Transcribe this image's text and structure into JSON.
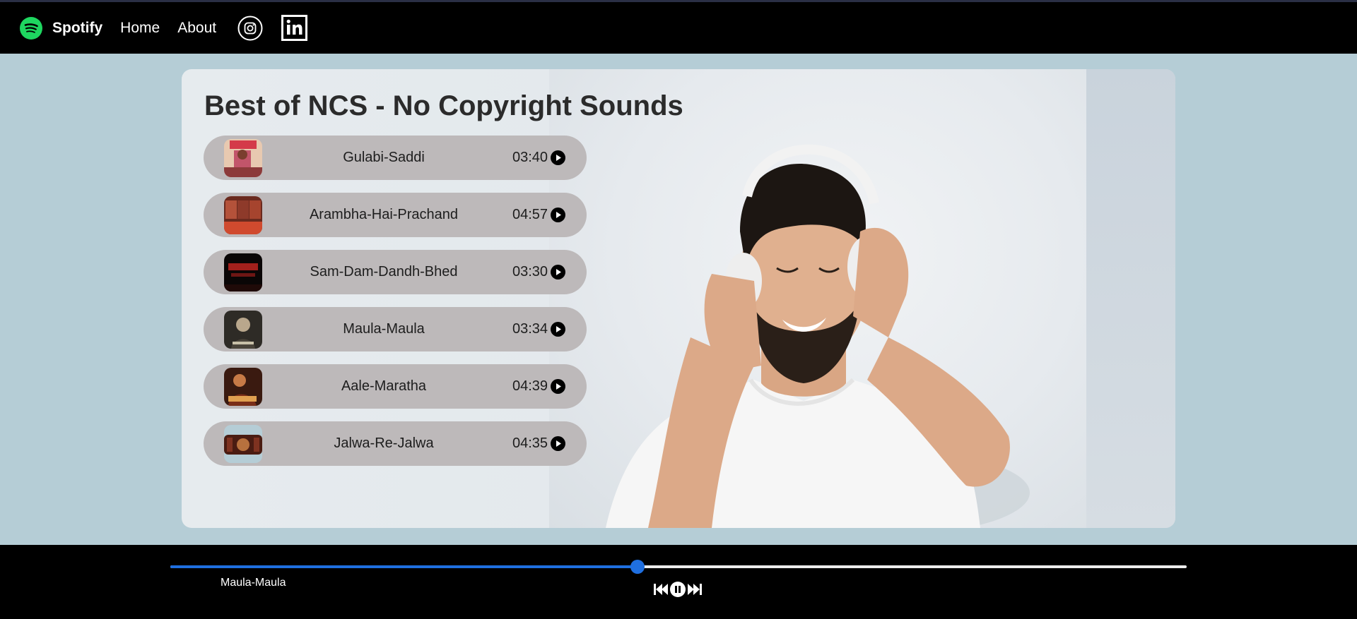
{
  "nav": {
    "brand": "Spotify",
    "links": [
      "Home",
      "About"
    ],
    "social": [
      "instagram-icon",
      "linkedin-icon"
    ]
  },
  "playlist": {
    "title": "Best of NCS - No Copyright Sounds",
    "songs": [
      {
        "name": "Gulabi-Saddi",
        "duration": "03:40"
      },
      {
        "name": "Arambha-Hai-Prachand",
        "duration": "04:57"
      },
      {
        "name": "Sam-Dam-Dandh-Bhed",
        "duration": "03:30"
      },
      {
        "name": "Maula-Maula",
        "duration": "03:34"
      },
      {
        "name": "Aale-Maratha",
        "duration": "04:39"
      },
      {
        "name": "Jalwa-Re-Jalwa",
        "duration": "04:35"
      }
    ]
  },
  "player": {
    "current_song": "Maula-Maula",
    "progress_percent": 46,
    "state": "playing"
  },
  "colors": {
    "brand_green": "#1ed760",
    "accent_blue": "#1f6fe0",
    "song_row_bg": "#bdb9ba",
    "page_bg": "#b5cdd6"
  }
}
